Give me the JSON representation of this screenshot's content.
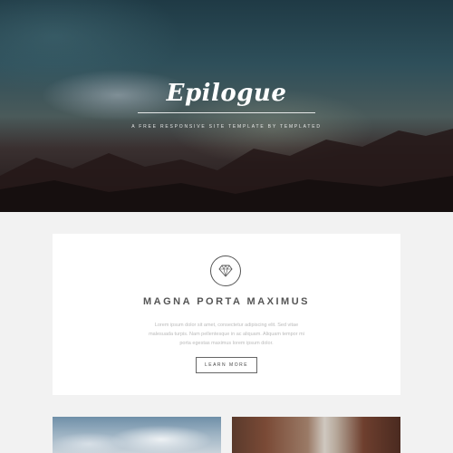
{
  "hero": {
    "logo": "Epilogue",
    "tagline": "A FREE RESPONSIVE SITE TEMPLATE BY TEMPLATED"
  },
  "feature": {
    "icon": "diamond-icon",
    "title": "MAGNA PORTA MAXIMUS",
    "text": "Lorem ipsum dolor sit amet, consectetur adipiscing elit. Sed vitae malesuada turpis. Nam pellentesque in ac aliquam. Aliquam tempor mi porta egestas maximus lorem ipsum dolor.",
    "button_label": "LEARN MORE"
  },
  "gallery": {
    "items": [
      {
        "name": "cloud-sky-photo"
      },
      {
        "name": "street-buildings-photo"
      }
    ]
  }
}
